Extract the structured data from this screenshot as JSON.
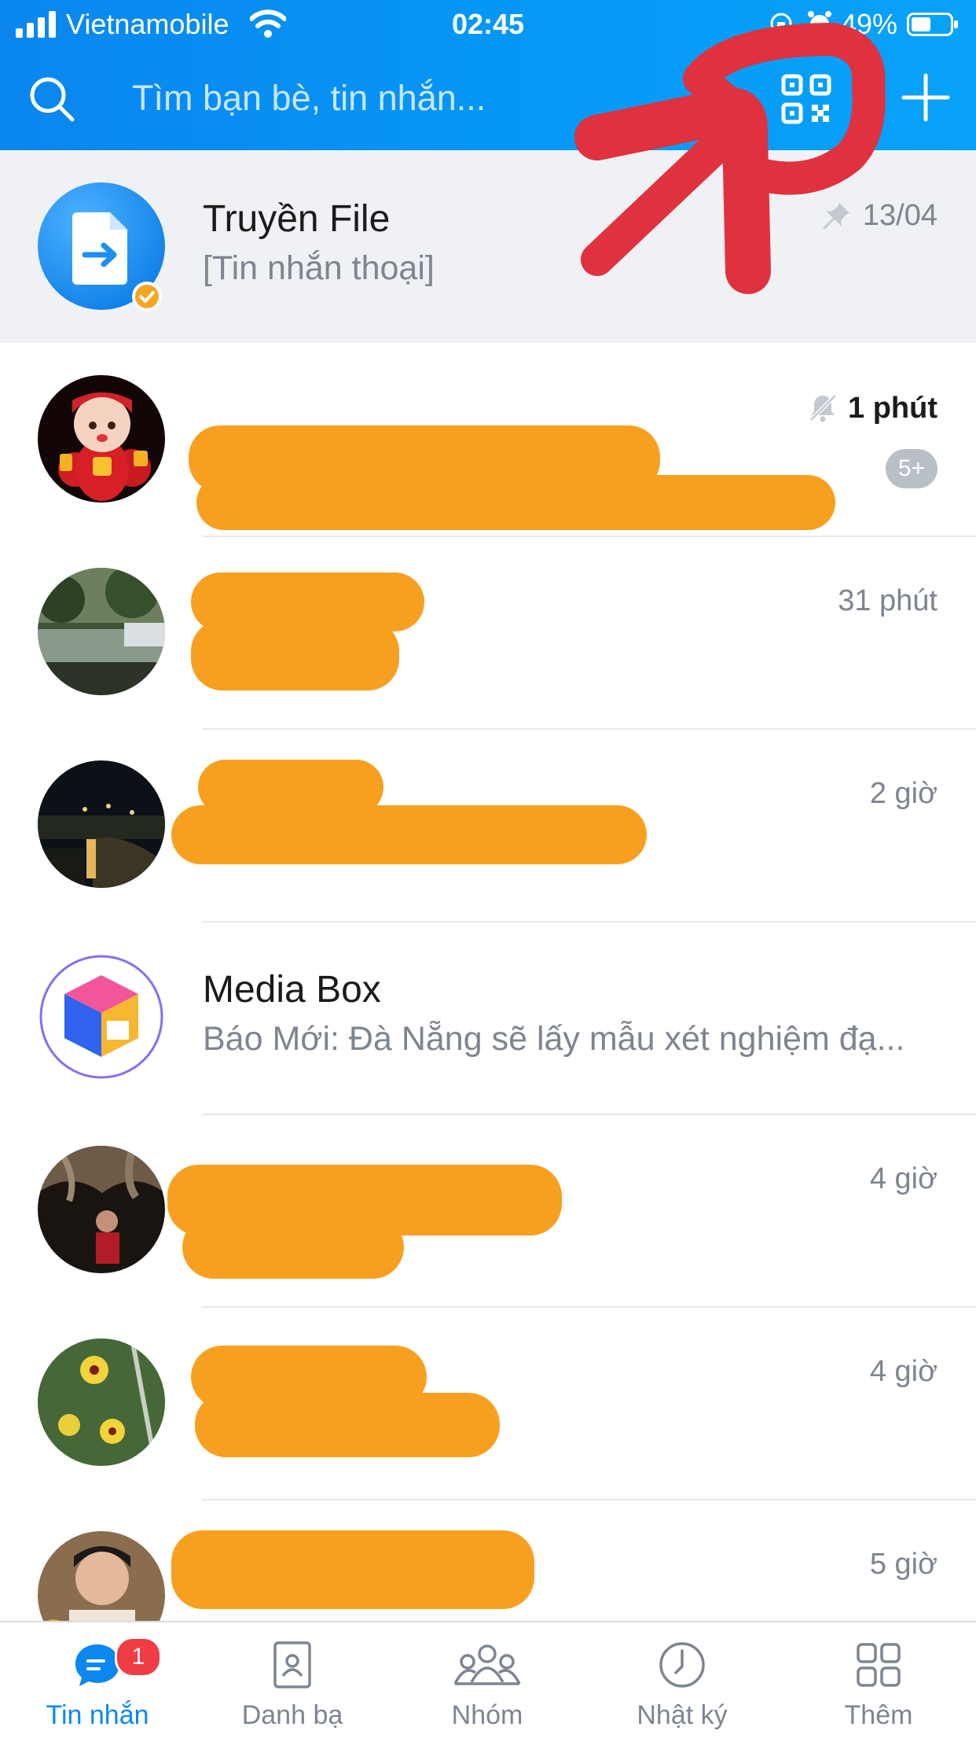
{
  "status_bar": {
    "carrier": "Vietnamobile",
    "time": "02:45",
    "battery_percent": "49%"
  },
  "search": {
    "placeholder": "Tìm bạn bè, tin nhắn..."
  },
  "colors": {
    "header_blue": "#0a86ef",
    "accent_blue": "#0b87f0",
    "annotation_red": "#e0313f",
    "redaction_orange": "#f7a020",
    "badge_red": "#ef3c45"
  },
  "conversations": [
    {
      "title": "Truyền File",
      "preview": "[Tin nhắn thoại]",
      "time": "13/04",
      "pinned": true,
      "verified": true
    },
    {
      "title": "",
      "preview": "",
      "time": "1 phút",
      "muted": true,
      "unread": "5+"
    },
    {
      "title": "",
      "preview": "",
      "time": "31 phút"
    },
    {
      "title": "",
      "preview": "",
      "time": "2 giờ"
    },
    {
      "title": "Media Box",
      "preview": "Báo Mới: Đà Nẵng sẽ lấy mẫu xét nghiệm đạ...",
      "time": ""
    },
    {
      "title": "",
      "preview": "",
      "time": "4 giờ"
    },
    {
      "title": "",
      "preview": "",
      "time": "4 giờ"
    },
    {
      "title": "",
      "preview": "",
      "time": "5 giờ"
    }
  ],
  "bottom_nav": [
    {
      "label": "Tin nhắn",
      "icon": "chat-bubble-icon",
      "badge": "1",
      "active": true
    },
    {
      "label": "Danh bạ",
      "icon": "contact-card-icon"
    },
    {
      "label": "Nhóm",
      "icon": "group-icon"
    },
    {
      "label": "Nhật ký",
      "icon": "clock-icon"
    },
    {
      "label": "Thêm",
      "icon": "grid-icon"
    }
  ]
}
